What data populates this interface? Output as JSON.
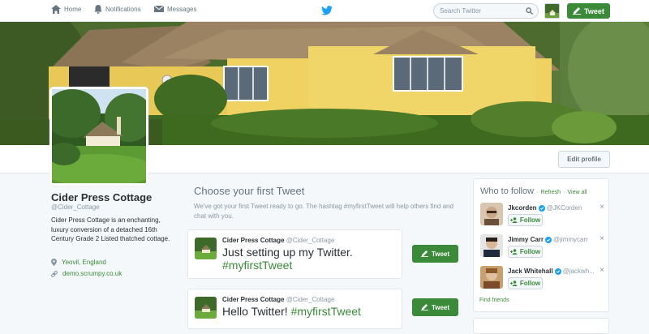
{
  "topbar": {
    "nav": [
      {
        "label": "Home",
        "icon": "home-icon"
      },
      {
        "label": "Notifications",
        "icon": "bell-icon"
      },
      {
        "label": "Messages",
        "icon": "envelope-icon"
      }
    ],
    "search_placeholder": "Search Twitter",
    "tweet_label": "Tweet"
  },
  "profile": {
    "name": "Cider Press Cottage",
    "handle": "@Cider_Cottage",
    "bio": "Cider Press Cottage is an enchanting, luxury conversion of a detached 16th Century Grade 2 Listed thatched cottage.",
    "location": "Yeovil, England",
    "url": "demo.scrumpy.co.uk",
    "edit_label": "Edit profile"
  },
  "main": {
    "title": "Choose your first Tweet",
    "description": "We've got your first Tweet ready to go. The hashtag #myfirstTweet will help others find and chat with you.",
    "cards": [
      {
        "author": "Cider Press Cottage",
        "handle": "@Cider_Cottage",
        "text": "Just setting up my Twitter.",
        "hashtag": "#myfirstTweet",
        "button": "Tweet"
      },
      {
        "author": "Cider Press Cottage",
        "handle": "@Cider_Cottage",
        "text": "Hello Twitter!",
        "hashtag": "#myfirstTweet",
        "button": "Tweet"
      }
    ]
  },
  "who_to_follow": {
    "title": "Who to follow",
    "refresh": "Refresh",
    "separator": "·",
    "view_all": "View all",
    "follow_label": "Follow",
    "users": [
      {
        "name": "Jkcorden",
        "handle": "@JKCorden"
      },
      {
        "name": "Jimmy Carr",
        "handle": "@jimmycarr"
      },
      {
        "name": "Jack Whitehall",
        "handle": "@jackwh..."
      }
    ],
    "find_friends": "Find friends"
  },
  "colors": {
    "accent": "#3a8a3a",
    "link": "#3a8a3a",
    "twitter_blue": "#1da1f2",
    "text": "#292f33",
    "muted": "#8899a6"
  }
}
